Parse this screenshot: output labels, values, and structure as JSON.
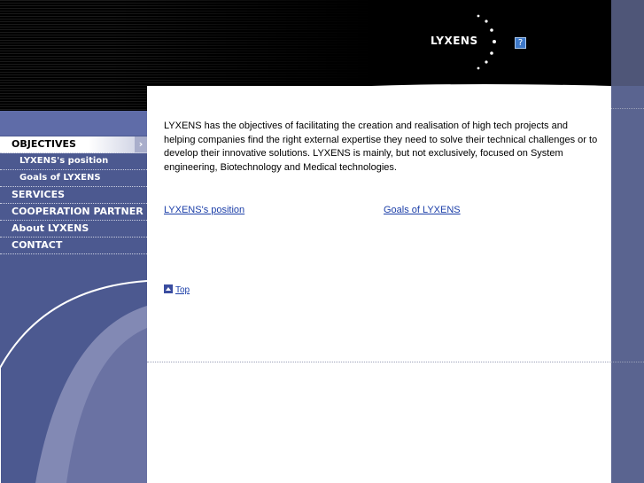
{
  "brand": {
    "name": "LYXENS",
    "help_glyph": "?"
  },
  "colors": {
    "header_bg": "#000000",
    "sidebar_bg": "#4c5990",
    "link": "#1b3ea8",
    "active_menu_bg": "#ffffff"
  },
  "menu": [
    {
      "label": "OBJECTIVES",
      "level": "top",
      "active": true
    },
    {
      "label": "LYXENS's position",
      "level": "sub"
    },
    {
      "label": "Goals of LYXENS",
      "level": "sub"
    },
    {
      "label": "SERVICES",
      "level": "top"
    },
    {
      "label": "COOPERATION PARTNER",
      "level": "top"
    },
    {
      "label": "About LYXENS",
      "level": "top"
    },
    {
      "label": "CONTACT",
      "level": "top"
    }
  ],
  "menu_arrow": "›",
  "main": {
    "intro": "LYXENS has the objectives of facilitating the creation and realisation of high tech projects and helping companies find the right external expertise they need to solve their technical challenges or to develop their innovative solutions. LYXENS is mainly, but not exclusively, focused on System engineering, Biotechnology and Medical technologies.",
    "links": {
      "position": "LYXENS's position",
      "goals": "Goals of LYXENS"
    },
    "top_link": "Top"
  }
}
